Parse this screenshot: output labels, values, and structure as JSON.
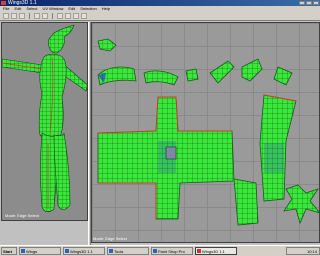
{
  "window": {
    "title": "Wings3D 1.1"
  },
  "menu": [
    "File",
    "Edit",
    "Select",
    "UV Window",
    "Edit",
    "Selection",
    "Help"
  ],
  "viewport_3d": {
    "status": "Mode: Edge Select"
  },
  "uv_editor": {
    "status": "Mode: Edge Select"
  },
  "taskbar": {
    "start_label": "Start",
    "tasks": [
      "Wings",
      "Wings3D 1.1",
      "Tools",
      "Paint Shop Pro",
      "Wings3D 1.1"
    ],
    "clock": "10:14"
  },
  "colors": {
    "mesh": "#39e83a",
    "wire": "#0d4a0d",
    "seam": "#d43a2a",
    "uv_stretch": "#2a3cd4",
    "bg": "#9a9a9a"
  }
}
